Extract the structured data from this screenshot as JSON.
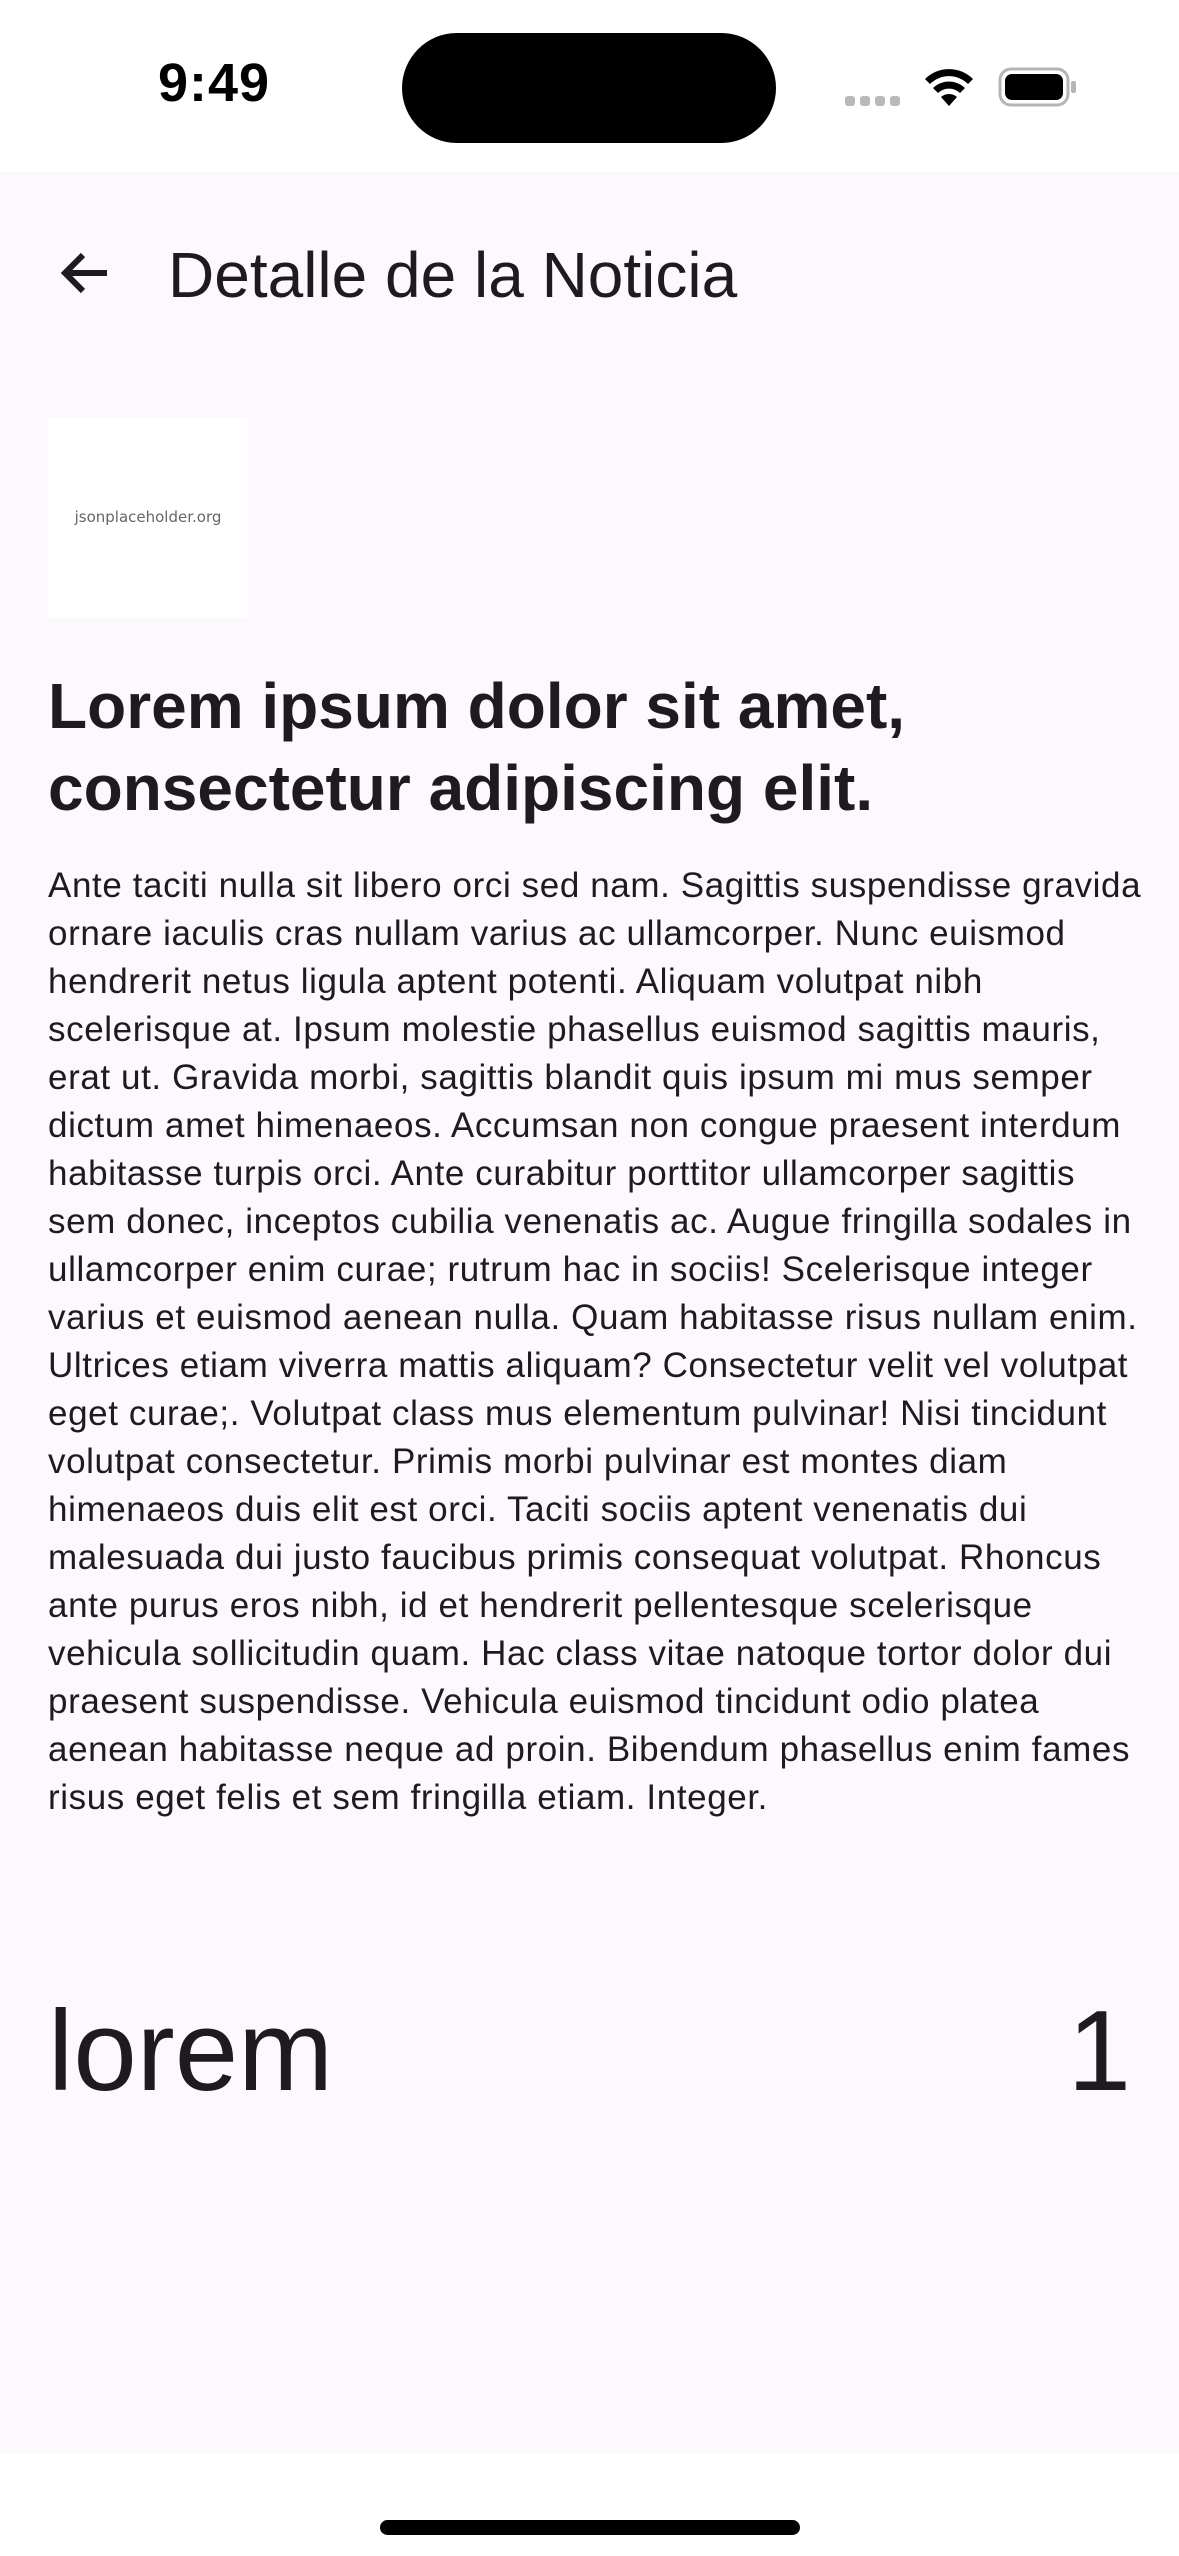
{
  "status_bar": {
    "time": "9:49"
  },
  "app_bar": {
    "title": "Detalle de la Noticia",
    "back_icon": "arrow-back-icon"
  },
  "article": {
    "thumbnail_text": "jsonplaceholder.org",
    "title": "Lorem ipsum dolor sit amet, consectetur adipiscing elit.",
    "body": "Ante taciti nulla sit libero orci sed nam. Sagittis suspendisse gravida ornare iaculis cras nullam varius ac ullamcorper. Nunc euismod hendrerit netus ligula aptent potenti. Aliquam volutpat nibh scelerisque at. Ipsum molestie phasellus euismod sagittis mauris, erat ut. Gravida morbi, sagittis blandit quis ipsum mi mus semper dictum amet himenaeos. Accumsan non congue praesent interdum habitasse turpis orci. Ante curabitur porttitor ullamcorper sagittis sem donec, inceptos cubilia venenatis ac. Augue fringilla sodales in ullamcorper enim curae; rutrum hac in sociis! Scelerisque integer varius et euismod aenean nulla. Quam habitasse risus nullam enim. Ultrices etiam viverra mattis aliquam? Consectetur velit vel volutpat eget curae;. Volutpat class mus elementum pulvinar! Nisi tincidunt volutpat consectetur. Primis morbi pulvinar est montes diam himenaeos duis elit est orci. Taciti sociis aptent venenatis dui malesuada dui justo faucibus primis consequat volutpat. Rhoncus ante purus eros nibh, id et hendrerit pellentesque scelerisque vehicula sollicitudin quam. Hac class vitae natoque tortor dolor dui praesent suspendisse. Vehicula euismod tincidunt odio platea aenean habitasse neque ad proin. Bibendum phasellus enim fames risus eget felis et sem fringilla etiam. Integer.",
    "category": "lorem",
    "id": "1"
  },
  "colors": {
    "background": "#fdf7fe",
    "text": "#1d1b20"
  }
}
